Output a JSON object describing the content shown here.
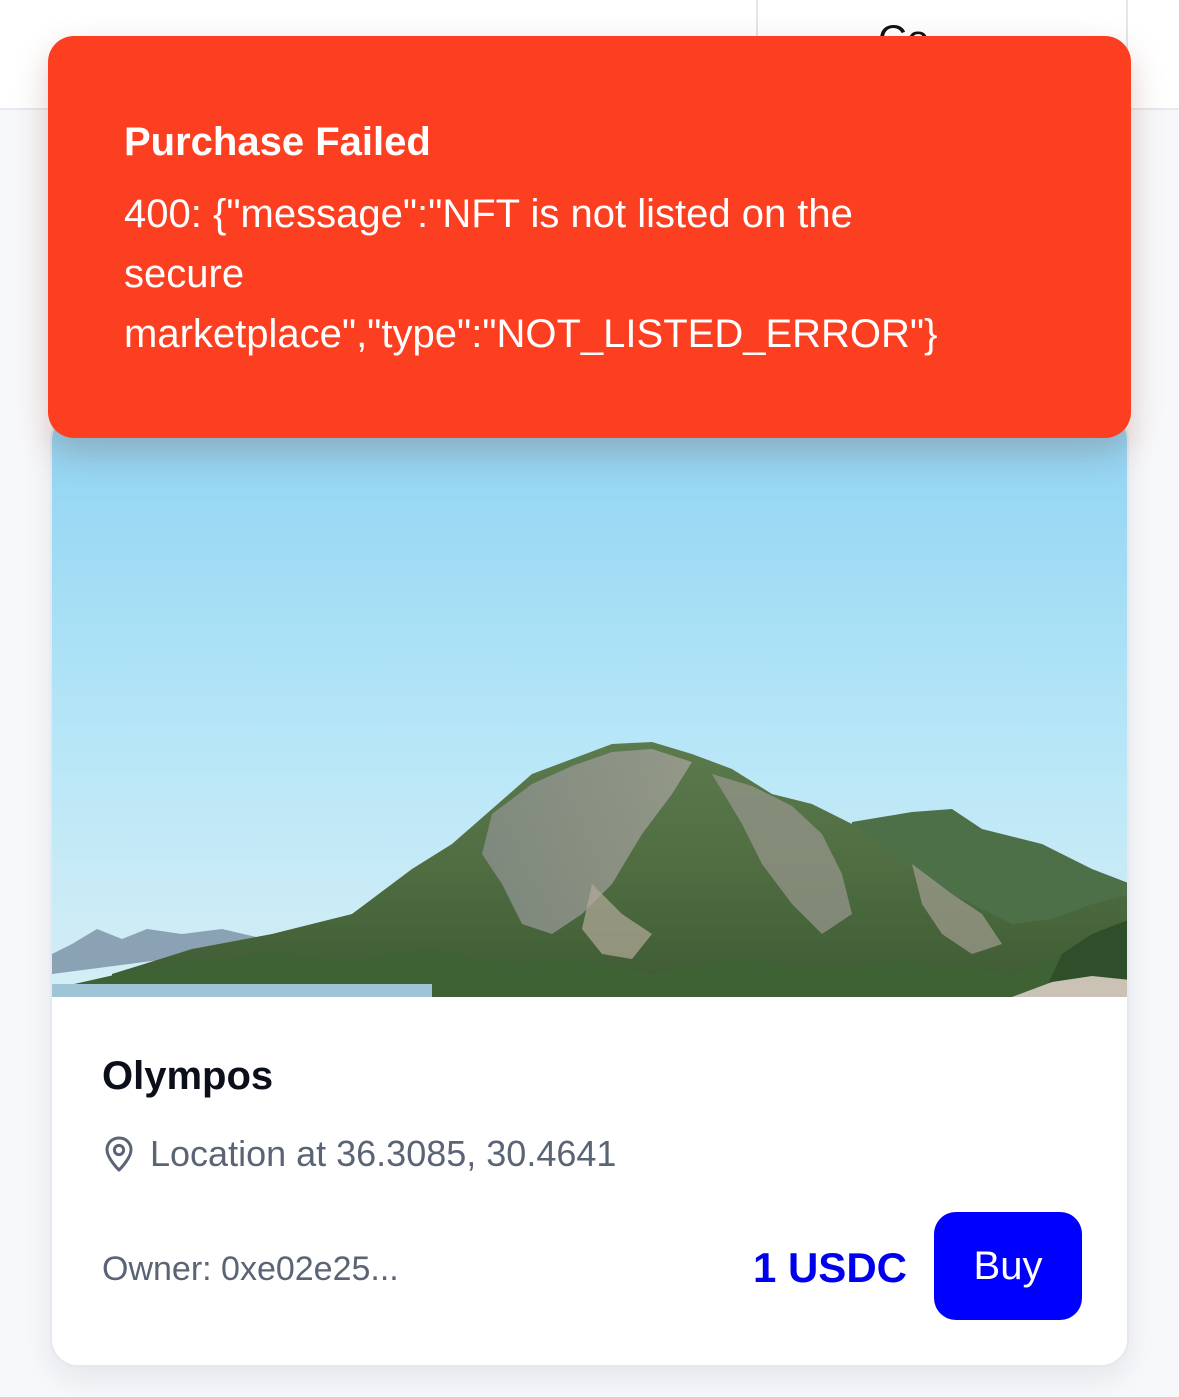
{
  "header": {
    "button_label": "Co"
  },
  "toast": {
    "title": "Purchase Failed",
    "message_lines": [
      "400: {\"message\":\"NFT is not listed on the",
      "secure",
      "marketplace\",\"type\":\"NOT_LISTED_ERROR\"}"
    ],
    "background_color": "#fc3f21"
  },
  "card": {
    "image_alt": "Mountain landscape above the sea",
    "title": "Olympos",
    "location_icon": "map-pin-icon",
    "location_text": "Location at 36.3085, 30.4641",
    "owner_text": "Owner: 0xe02e25...",
    "price_text": "1 USDC",
    "buy_label": "Buy",
    "accent_color": "#0000ff"
  }
}
